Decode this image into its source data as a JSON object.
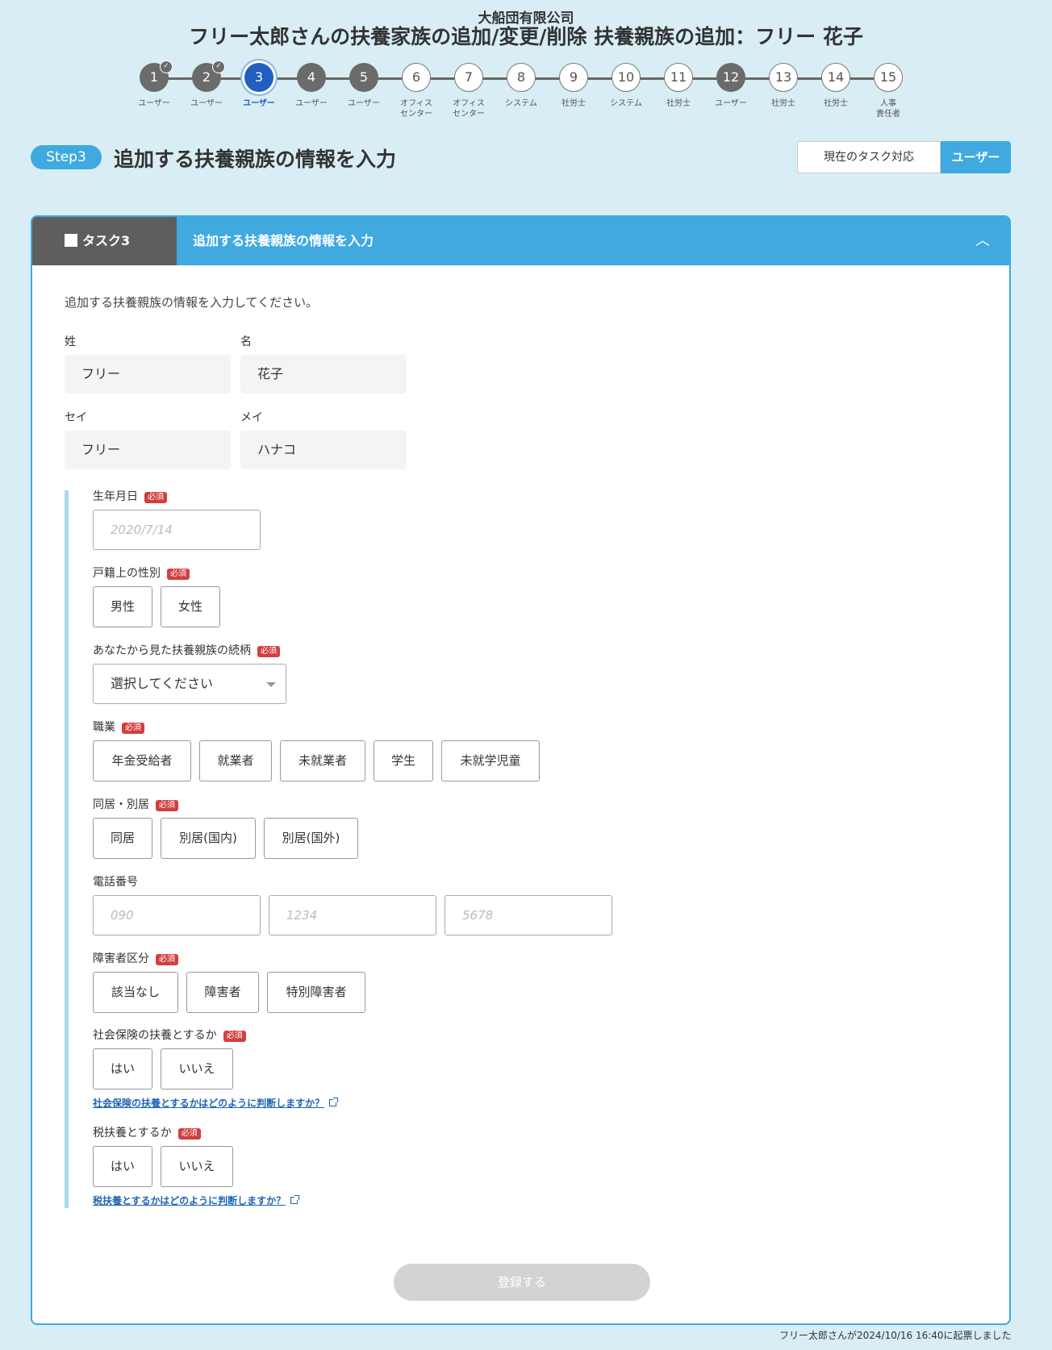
{
  "header": {
    "company": "大船団有限公司",
    "title": "フリー太郎さんの扶養家族の追加/変更/削除 扶養親族の追加：フリー 花子"
  },
  "stepper": [
    {
      "num": "1",
      "label": "ユーザー",
      "state": "done"
    },
    {
      "num": "2",
      "label": "ユーザー",
      "state": "done"
    },
    {
      "num": "3",
      "label": "ユーザー",
      "state": "current"
    },
    {
      "num": "4",
      "label": "ユーザー",
      "state": "filled"
    },
    {
      "num": "5",
      "label": "ユーザー",
      "state": "filled"
    },
    {
      "num": "6",
      "label": "オフィス\nセンター",
      "state": "white"
    },
    {
      "num": "7",
      "label": "オフィス\nセンター",
      "state": "white"
    },
    {
      "num": "8",
      "label": "システム",
      "state": "white"
    },
    {
      "num": "9",
      "label": "社労士",
      "state": "white"
    },
    {
      "num": "10",
      "label": "システム",
      "state": "white"
    },
    {
      "num": "11",
      "label": "社労士",
      "state": "white"
    },
    {
      "num": "12",
      "label": "ユーザー",
      "state": "filled"
    },
    {
      "num": "13",
      "label": "社労士",
      "state": "white"
    },
    {
      "num": "14",
      "label": "社労士",
      "state": "white"
    },
    {
      "num": "15",
      "label": "人事\n責任者",
      "state": "white"
    }
  ],
  "step": {
    "badge": "Step3",
    "title": "追加する扶養親族の情報を入力",
    "task_button": "現在のタスク対応",
    "role_button": "ユーザー"
  },
  "card": {
    "task_tab": "タスク3",
    "title": "追加する扶養親族の情報を入力",
    "collapse_icon": "chevron-up-icon",
    "intro": "追加する扶養親族の情報を入力してください。"
  },
  "name": {
    "last_label": "姓",
    "last_value": "フリー",
    "first_label": "名",
    "first_value": "花子",
    "last_kana_label": "セイ",
    "last_kana_value": "フリー",
    "first_kana_label": "メイ",
    "first_kana_value": "ハナコ"
  },
  "required_badge": "必須",
  "birthdate": {
    "label": "生年月日",
    "placeholder": "2020/7/14"
  },
  "gender": {
    "label": "戸籍上の性別",
    "options": [
      "男性",
      "女性"
    ]
  },
  "relation": {
    "label": "あなたから見た扶養親族の続柄",
    "value": "選択してください"
  },
  "occupation": {
    "label": "職業",
    "options": [
      "年金受給者",
      "就業者",
      "未就業者",
      "学生",
      "未就学児童"
    ]
  },
  "residence": {
    "label": "同居・別居",
    "options": [
      "同居",
      "別居(国内)",
      "別居(国外)"
    ]
  },
  "phone": {
    "label": "電話番号",
    "placeholders": [
      "090",
      "1234",
      "5678"
    ]
  },
  "disability": {
    "label": "障害者区分",
    "options": [
      "該当なし",
      "障害者",
      "特別障害者"
    ]
  },
  "social_insurance": {
    "label": "社会保険の扶養とするか",
    "options": [
      "はい",
      "いいえ"
    ],
    "help": "社会保険の扶養とするかはどのように判断しますか？"
  },
  "tax_dependent": {
    "label": "税扶養とするか",
    "options": [
      "はい",
      "いいえ"
    ],
    "help": "税扶養とするかはどのように判断しますか？"
  },
  "submit_label": "登録する",
  "footer_note": "フリー太郎さんが2024/10/16 16:40に起票しました",
  "colors": {
    "accent": "#3fa9e0",
    "current_step": "#1f5fbf",
    "required": "#d23f3f",
    "background": "#d8edf4"
  }
}
